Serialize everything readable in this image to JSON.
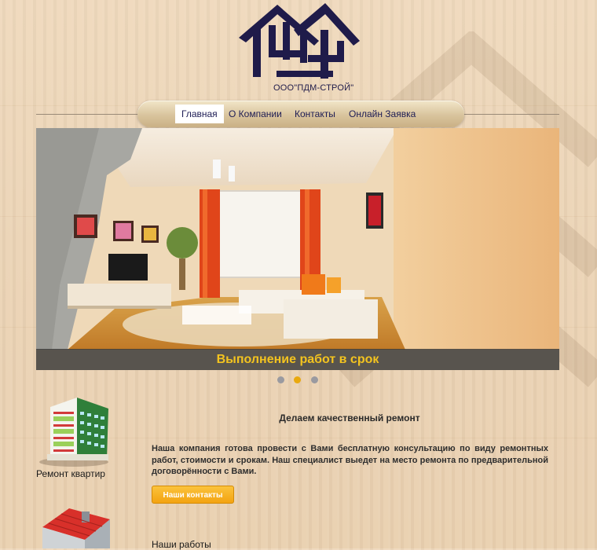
{
  "header": {
    "company_name": "ООО\"ПДМ-СТРОЙ\""
  },
  "nav": {
    "items": [
      {
        "label": "Главная",
        "active": true
      },
      {
        "label": "О Компании",
        "active": false
      },
      {
        "label": "Контакты",
        "active": false
      },
      {
        "label": "Онлайн Заявка",
        "active": false
      }
    ]
  },
  "slider": {
    "caption": "Выполнение работ в срок",
    "dots": [
      "inactive",
      "active",
      "inactive"
    ],
    "slide_count": 3,
    "active_index": 2
  },
  "services": [
    {
      "label": "Ремонт квартир",
      "icon": "apartment-building-icon"
    },
    {
      "label": "",
      "icon": "house-roof-icon"
    }
  ],
  "main": {
    "heading": "Делаем качественный ремонт",
    "paragraph": "Наша компания готова провести с Вами бесплатную консультацию по виду ремонтных работ, стоимости и срокам. Наш специалист выедет на место ремонта по предварительной договорённости с Вами.",
    "contact_button": "Наши контакты",
    "works_label": "Наши работы"
  },
  "colors": {
    "nav_text": "#1e1d55",
    "caption_text": "#f3c31f",
    "button": "#f3a311",
    "dot_active": "#e9a90f",
    "logo": "#1f1b4a"
  }
}
